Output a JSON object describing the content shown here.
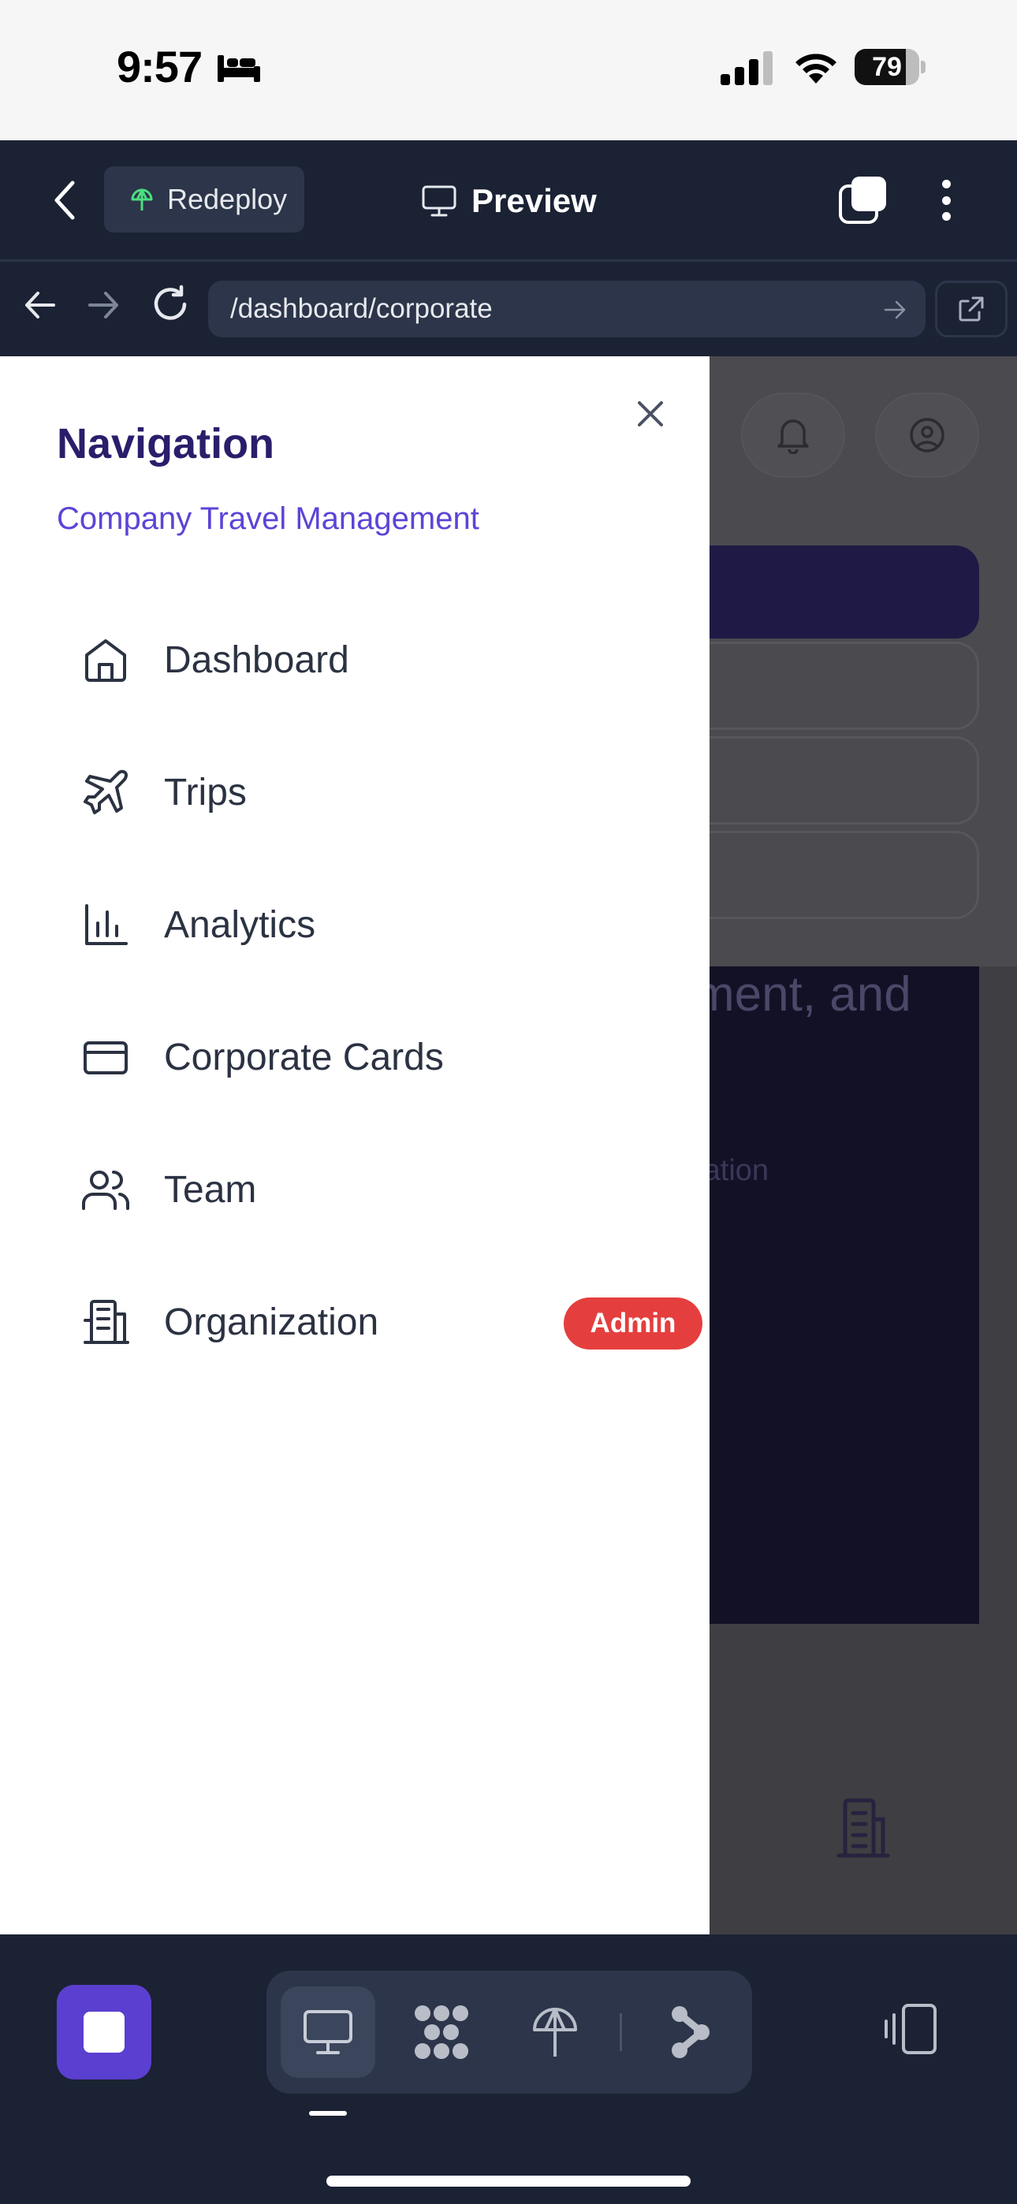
{
  "status": {
    "time": "9:57",
    "battery": "79",
    "battery_level": 0.79
  },
  "topbar": {
    "redeploy_label": "Redeploy",
    "preview_label": "Preview"
  },
  "urlbar": {
    "url": "/dashboard/corporate"
  },
  "background_page": {
    "hero_fragment": "ment, and",
    "sub_fragment": "ration"
  },
  "drawer": {
    "title": "Navigation",
    "subtitle": "Company Travel Management",
    "items": [
      {
        "label": "Dashboard",
        "icon": "home-icon"
      },
      {
        "label": "Trips",
        "icon": "plane-icon"
      },
      {
        "label": "Analytics",
        "icon": "bar-chart-icon"
      },
      {
        "label": "Corporate Cards",
        "icon": "credit-card-icon"
      },
      {
        "label": "Team",
        "icon": "users-icon"
      },
      {
        "label": "Organization",
        "icon": "building-icon",
        "badge": "Admin"
      }
    ]
  },
  "bottombar": {
    "modes": [
      "desktop-icon",
      "apps-grid-icon",
      "deploy-icon",
      "share-icon"
    ],
    "active_mode": "desktop-icon"
  },
  "colors": {
    "accent": "#5b3fd0",
    "title": "#2a1e6b",
    "subtitle": "#5b45d6",
    "badge": "#e53e3e",
    "chrome": "#1b2234"
  }
}
